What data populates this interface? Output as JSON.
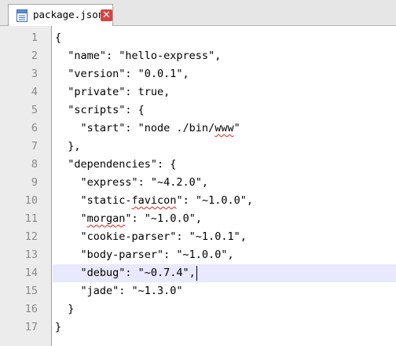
{
  "tab": {
    "label": "package.json",
    "file_icon": "file-icon",
    "close_icon": "close-icon",
    "close_glyph": "✕",
    "close_color": "#d84343"
  },
  "editor": {
    "current_line": 14,
    "current_line_color": "#e8e8ff",
    "lines": [
      {
        "number": "1",
        "text": "{"
      },
      {
        "number": "2",
        "text": "  \"name\": \"hello-express\","
      },
      {
        "number": "3",
        "text": "  \"version\": \"0.0.1\","
      },
      {
        "number": "4",
        "text": "  \"private\": true,"
      },
      {
        "number": "5",
        "text": "  \"scripts\": {"
      },
      {
        "number": "6",
        "text": "    \"start\": \"node ./bin/www\""
      },
      {
        "number": "7",
        "text": "  },"
      },
      {
        "number": "8",
        "text": "  \"dependencies\": {"
      },
      {
        "number": "9",
        "text": "    \"express\": \"~4.2.0\","
      },
      {
        "number": "10",
        "text": "    \"static-favicon\": \"~1.0.0\","
      },
      {
        "number": "11",
        "text": "    \"morgan\": \"~1.0.0\","
      },
      {
        "number": "12",
        "text": "    \"cookie-parser\": \"~1.0.1\","
      },
      {
        "number": "13",
        "text": "    \"body-parser\": \"~1.0.0\","
      },
      {
        "number": "14",
        "text": "    \"debug\": \"~0.7.4\","
      },
      {
        "number": "15",
        "text": "    \"jade\": \"~1.3.0\""
      },
      {
        "number": "16",
        "text": "  }"
      },
      {
        "number": "17",
        "text": "}"
      }
    ],
    "misspelled_words": [
      "www",
      "favicon",
      "morgan"
    ]
  }
}
